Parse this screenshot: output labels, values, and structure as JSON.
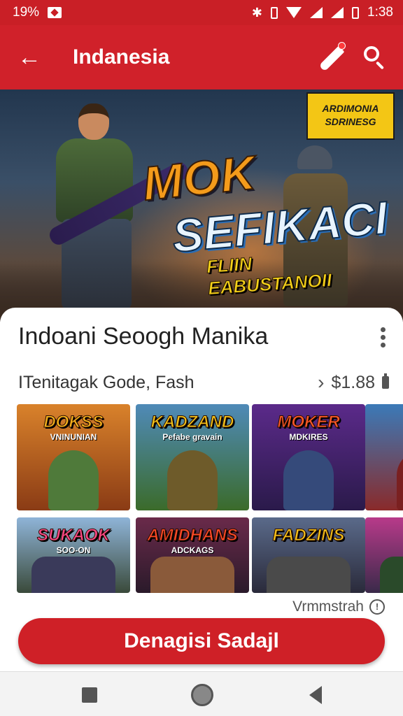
{
  "status_bar": {
    "left_text": "19%",
    "time": "1:38"
  },
  "app_bar": {
    "title": "Indanesia"
  },
  "hero": {
    "badge_line1": "ARDIMONIA",
    "badge_line2": "SDRINESG",
    "title_line1": "MOK",
    "title_line2": "SEFIKACI",
    "subtitle": "FLIIN EABUSTANOII"
  },
  "product": {
    "name": "Indoani Seoogh Manika",
    "meta": "ITenitagak Gode, Fash",
    "price": "$1.88"
  },
  "thumbnails": [
    {
      "title": "DOKSS",
      "subtitle": "VNINUNIAN",
      "title_color": "#f5b21c",
      "bg": "linear-gradient(180deg,#d9822b,#8a3b15)",
      "fig_color": "#4f7a3a"
    },
    {
      "title": "KADZAND",
      "subtitle": "Pefabe gravain",
      "title_color": "#f2c21a",
      "bg": "linear-gradient(180deg,#4f8ab8,#3b6b2a)",
      "fig_color": "#6e5b2a"
    },
    {
      "title": "MOKER",
      "subtitle": "MDKIRES",
      "title_color": "#ff5a28",
      "bg": "linear-gradient(180deg,#5b2a8a,#2a1a4a)",
      "fig_color": "#354a7a"
    },
    {
      "title": "",
      "subtitle": "",
      "title_color": "#ffffff",
      "bg": "linear-gradient(180deg,#3b7ab8,#8a2a2a)",
      "fig_color": "#7a2020"
    },
    {
      "title": "SUKAOK",
      "subtitle": "SOO-ON",
      "title_color": "#ff4a8a",
      "bg": "linear-gradient(180deg,#8fb4d8,#3a4a3a)",
      "fig_color": "#3a3a5a"
    },
    {
      "title": "AMIDHANS",
      "subtitle": "ADCKAGS",
      "title_color": "#ff4a28",
      "bg": "linear-gradient(180deg,#6a2a4a,#2a1a2a)",
      "fig_color": "#8a5a3a"
    },
    {
      "title": "FADZINS",
      "subtitle": "",
      "title_color": "#f5c21a",
      "bg": "linear-gradient(180deg,#5a6a8a,#2a2a3a)",
      "fig_color": "#4a4a4a"
    },
    {
      "title": "",
      "subtitle": "",
      "title_color": "#ffffff",
      "bg": "linear-gradient(180deg,#b83a8a,#3a2a4a)",
      "fig_color": "#2a4a2a"
    }
  ],
  "footnote": {
    "text": "Vrmmstrah"
  },
  "cta": {
    "label": "Denagisi Sadajl"
  },
  "icons": [
    "back-arrow-icon",
    "pen-icon",
    "search-icon",
    "more-vert-icon",
    "chevron-right-icon",
    "battery-icon",
    "info-icon",
    "recents-icon",
    "home-icon",
    "back-icon"
  ],
  "colors": {
    "primary": "#d0212a",
    "status_bar": "#c91f26"
  }
}
